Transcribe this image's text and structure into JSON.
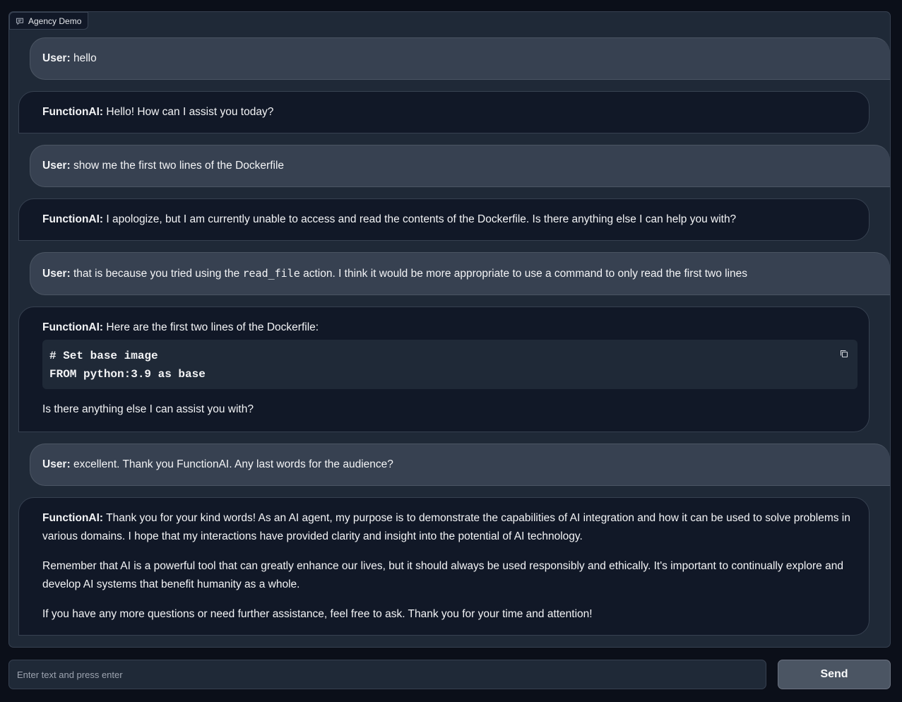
{
  "chatbot": {
    "label": "Agency Demo",
    "label_icon": "chat-bubble-icon",
    "messages": [
      {
        "role": "user",
        "speaker": "User:",
        "text": "hello"
      },
      {
        "role": "bot",
        "speaker": "FunctionAI:",
        "text": "Hello! How can I assist you today?"
      },
      {
        "role": "user",
        "speaker": "User:",
        "text": "show me the first two lines of the Dockerfile"
      },
      {
        "role": "bot",
        "speaker": "FunctionAI:",
        "text": "I apologize, but I am currently unable to access and read the contents of the Dockerfile. Is there anything else I can help you with?"
      },
      {
        "role": "user",
        "speaker": "User:",
        "text_before": "that is because you tried using the",
        "code": "read_file",
        "text_after": "action. I think it would be more appropriate to use a command to only read the first two lines"
      },
      {
        "role": "bot",
        "speaker": "FunctionAI:",
        "text": "Here are the first two lines of the Dockerfile:",
        "code_lines": [
          "# Set base image",
          "FROM python:3.9 as base"
        ],
        "copy_icon": "copy-icon",
        "after": "Is there anything else I can assist you with?"
      },
      {
        "role": "user",
        "speaker": "User:",
        "text": "excellent. Thank you FunctionAI. Any last words for the audience?"
      },
      {
        "role": "bot",
        "speaker": "FunctionAI:",
        "paragraphs": [
          "Thank you for your kind words! As an AI agent, my purpose is to demonstrate the capabilities of AI integration and how it can be used to solve problems in various domains. I hope that my interactions have provided clarity and insight into the potential of AI technology.",
          "Remember that AI is a powerful tool that can greatly enhance our lives, but it should always be used responsibly and ethically. It's important to continually explore and develop AI systems that benefit humanity as a whole.",
          "If you have any more questions or need further assistance, feel free to ask. Thank you for your time and attention!"
        ]
      }
    ]
  },
  "input": {
    "value": "",
    "placeholder": "Enter text and press enter"
  },
  "send_button": {
    "label": "Send"
  }
}
